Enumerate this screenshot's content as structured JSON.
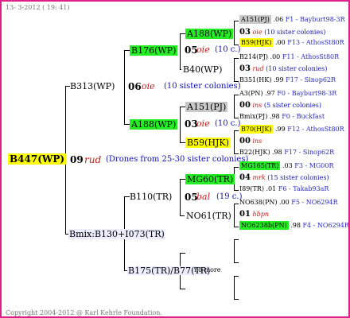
{
  "header": {
    "date": "13- 3-2012 ( 19: 41)"
  },
  "footer": {
    "copyright": "Copyright 2004-2012 @ Karl Kehrle Foundation."
  },
  "root": {
    "name": "B447(WP)",
    "mating_year": "09",
    "mating_code": "rud",
    "mating_note": "(Drones from 25-30 sister colonies)"
  },
  "queen_line": {
    "name": "B313(WP)",
    "mating_year": "06",
    "mating_code": "oie",
    "mating_note": "(10 sister colonies)"
  },
  "drone_line": {
    "name": "Bmix:B130+I07",
    "name_suffix": "3(TR)"
  },
  "gen3": {
    "b176": {
      "name": "B176(WP)",
      "mating_year": "05",
      "mating_code": "oie",
      "mating_note": "(10 c.)"
    },
    "a188": {
      "name": "A188(WP)",
      "mating_year": "03",
      "mating_code": "oie",
      "mating_note": "(10 c.)"
    },
    "b110": {
      "name": "B110(TR)",
      "mating_year": "05",
      "mating_code": "bal",
      "mating_note": "(19 c.)"
    },
    "b175": {
      "name": "B175(TR)/B77(TR)",
      "note": "no more"
    }
  },
  "gen4": {
    "a188_top": {
      "name": "A188(WP)"
    },
    "b40": {
      "name": "B40(WP)"
    },
    "a151": {
      "name": "A151(PJ)"
    },
    "b59": {
      "name": "B59(HJK)"
    },
    "mg60": {
      "name": "MG60(TR)"
    },
    "no61": {
      "name": "NO61(TR)"
    }
  },
  "gen5": {
    "r1": {
      "name": "A151(PJ)",
      "year": ".06",
      "origin": "F1 - Bayburt98-3R"
    },
    "r2": {
      "year": "03",
      "code": "oie",
      "note": "(10 sister colonies)"
    },
    "r3": {
      "name": "B59(HJK)",
      "year": ".00",
      "origin": "F13 - AthosSt80R"
    },
    "r4": {
      "name": "B214(PJ)",
      "year": ".00",
      "origin": "F11 - AthosSt80R"
    },
    "r5": {
      "year": "03",
      "code": "rud",
      "note": "(10 sister colonies)"
    },
    "r6": {
      "name": "B351(HK)",
      "year": ".99",
      "origin": "F17 - Sinop62R"
    },
    "r7": {
      "name": "A3(PN)",
      "year": ".97",
      "origin": "F0 - Bayburt98-3R"
    },
    "r8": {
      "year": "00",
      "code": "ins",
      "note": "(5 sister colonies)"
    },
    "r9": {
      "name": "Bmix(PJ)",
      "year": ".98",
      "origin": "F0 - Buckfast"
    },
    "r10": {
      "name": "B70(HJK)",
      "year": ".99",
      "origin": "F12 - AthosSt80R"
    },
    "r11": {
      "year": "00",
      "code": "ins"
    },
    "r12": {
      "name": "B22(HJK)",
      "year": ".98",
      "origin": "F17 - Sinop62R"
    },
    "r13": {
      "name": "MG165(TR)",
      "year": ".03",
      "origin": "F3 - MG00R"
    },
    "r14": {
      "year": "04",
      "code": "mrk",
      "note": "(15 sister colonies)"
    },
    "r15": {
      "name": "I89(TR)",
      "year": ".01",
      "origin": "F6 - Takab93aR"
    },
    "r16": {
      "name": "NO638(PN)",
      "year": ".00",
      "origin": "F5 - NO6294R"
    },
    "r17": {
      "year": "01",
      "code": "hbpn"
    },
    "r18": {
      "name": "NO6238b(PN)",
      "year": ".98",
      "origin": "F4 - NO6294R"
    }
  },
  "colors": {
    "border": "#e0208a",
    "root_bg": "#ffff00",
    "green_bg": "#22ee22",
    "gray_bg": "#c8c8c8",
    "yellow_bg": "#ffff00",
    "lavender_bg": "#eeeeff",
    "mating_code": "#c81818",
    "note": "#1010c0"
  }
}
